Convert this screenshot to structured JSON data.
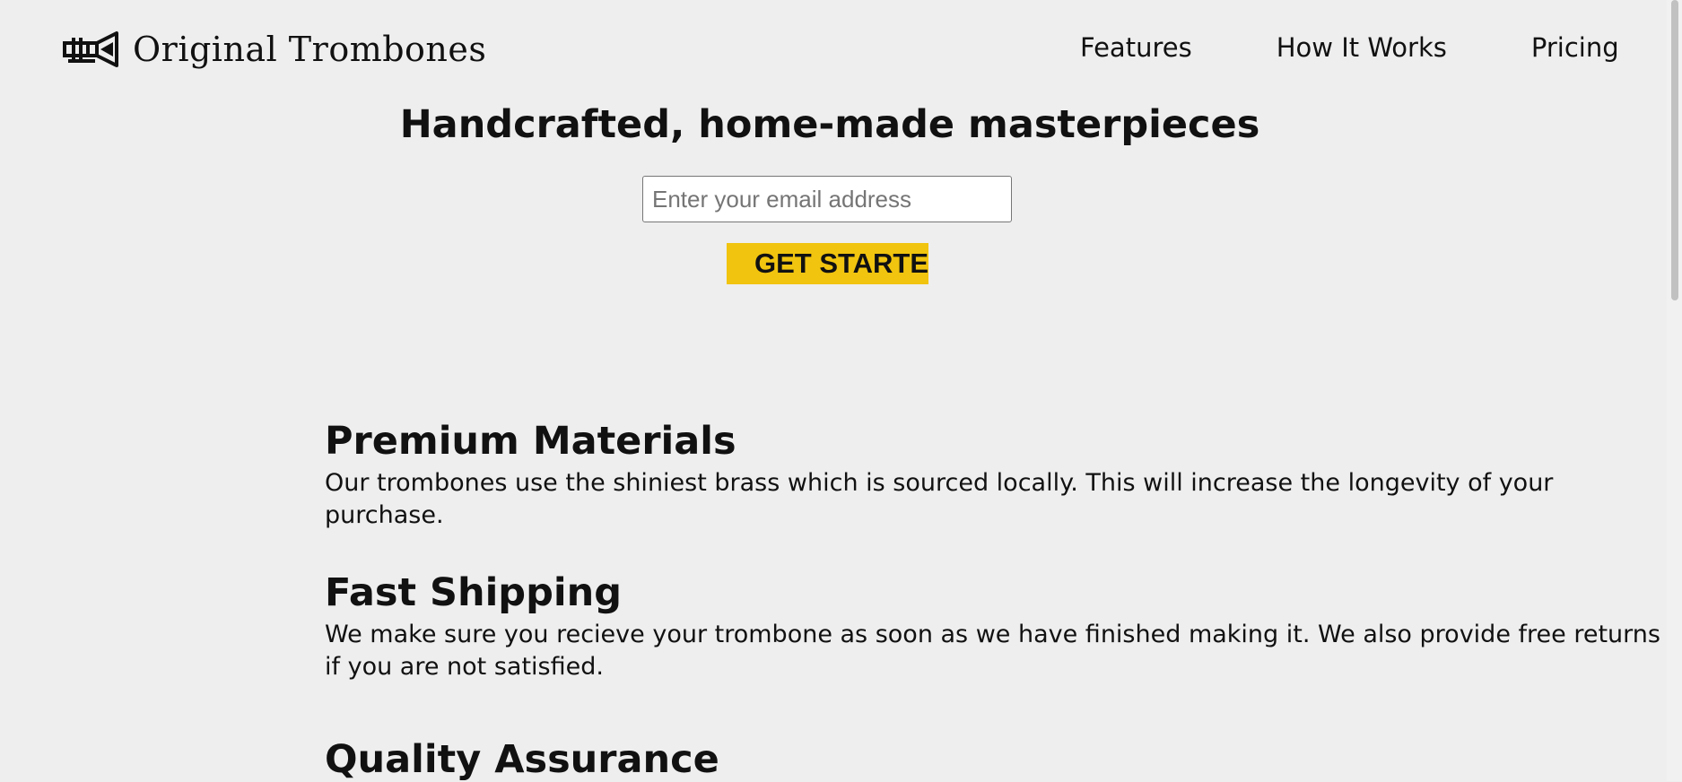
{
  "header": {
    "logo_text": "Original Trombones",
    "logo_icon": "trombone-icon",
    "nav": [
      {
        "label": "Features"
      },
      {
        "label": "How It Works"
      },
      {
        "label": "Pricing"
      }
    ]
  },
  "hero": {
    "title": "Handcrafted, home-made masterpieces",
    "email_placeholder": "Enter your email address",
    "cta_label": "GET STARTED"
  },
  "features": [
    {
      "title": "Premium Materials",
      "text": "Our trombones use the shiniest brass which is sourced locally. This will increase the longevity of your purchase."
    },
    {
      "title": "Fast Shipping",
      "text": "We make sure you recieve your trombone as soon as we have finished making it. We also provide free returns if you are not satisfied."
    },
    {
      "title": "Quality Assurance",
      "text": ""
    }
  ],
  "colors": {
    "background": "#eeeeee",
    "accent": "#f1c40f",
    "text": "#111111"
  }
}
